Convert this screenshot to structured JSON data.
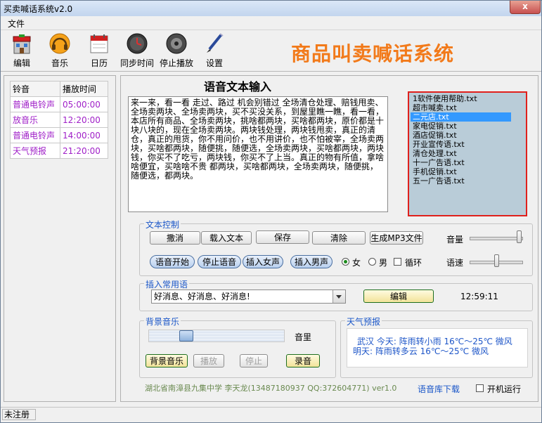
{
  "window": {
    "title": "买卖喊话系统v2.0",
    "close_label": "x"
  },
  "menu": {
    "file": "文件"
  },
  "toolbar": {
    "edit": "编辑",
    "music": "音乐",
    "calendar": "日历",
    "sync_time": "同步时间",
    "stop_play": "停止播放",
    "settings": "设置"
  },
  "app_title": "商品叫卖喊话系统",
  "ring_table": {
    "headers": [
      "铃音",
      "播放时间"
    ],
    "rows": [
      [
        "普通电铃声",
        "05:00:00"
      ],
      [
        "放音乐",
        "12:20:00"
      ],
      [
        "普通电铃声",
        "14:00:00"
      ],
      [
        "天气预报",
        "21:20:00"
      ]
    ]
  },
  "voice_input": {
    "heading": "语音文本输入",
    "text": "来一来，看一看 走过、路过 机会别错过 全场清仓处理、赔钱甩卖、全场卖两块、全场卖两块，买不买没关系，到屋里瞧一瞧，看一看，本店所有商品、全场卖两块，挑啥都两块，买啥都两块，原价都是十块八块的，现在全场卖两块。两块钱处理，两块钱甩卖，真正的清仓，真正的甩货，你不用问价，也不用讲价，也不怕被宰，全场卖两块，买啥都两块，随便挑，随便选，全场卖两块，买啥都两块，两块钱，你买不了吃亏，两块钱，你买不了上当。真正的物有所值，拿啥啥便宜，买啥啥不贵 都两块，买啥都两块，全场卖两块，随便挑，随便选，都两块。"
  },
  "file_list": {
    "items": [
      "1软件使用帮助.txt",
      "超市喊卖.txt",
      "二元店.txt",
      "家电促销.txt",
      "酒店促销.txt",
      "开业宣传语.txt",
      "清仓处理.txt",
      "十一广告语.txt",
      "手机促销.txt",
      "五一广告语.txt"
    ],
    "selected_index": 2
  },
  "text_control": {
    "title": "文本控制",
    "undo": "撒消",
    "load_text": "载入文本",
    "save": "保存",
    "clear": "清除",
    "gen_mp3": "生成MP3文件",
    "voice_start": "语音开始",
    "voice_stop": "停止语音",
    "insert_female": "插入女声",
    "insert_male": "插入男声",
    "female": "女",
    "male": "男",
    "loop": "循环",
    "volume_label": "音量",
    "speed_label": "语速",
    "volume_level": 0.95,
    "speed_level": 0.5
  },
  "common_phrases": {
    "title": "插入常用语",
    "selected": "好消息、好消息、好消息!",
    "edit": "编辑",
    "time": "12:59:11"
  },
  "bg_music": {
    "title": "背景音乐",
    "volume_label": "音里",
    "level": 0.25,
    "bg_music": "背景音乐",
    "play": "播放",
    "stop": "停止",
    "record": "录音"
  },
  "weather": {
    "title": "天气预报",
    "today": "武汉  今天: 阵雨转小雨 16℃～25℃ 微风",
    "tomorrow": "明天: 阵雨转多云 16℃～25℃ 微风"
  },
  "footer": {
    "credit": "湖北省南漳县九集中学  李天龙(13487180937 QQ:372604771)  ver1.0",
    "download": "语音库下载",
    "autostart": "开机运行"
  },
  "status": {
    "registration": "未注册"
  },
  "colors": {
    "accent_title": "#f27a1a",
    "ring_text": "#a020c8",
    "group_title": "#1a56c8",
    "file_list_bg": "#b9ccd8",
    "highlight_border": "#e0201c"
  }
}
